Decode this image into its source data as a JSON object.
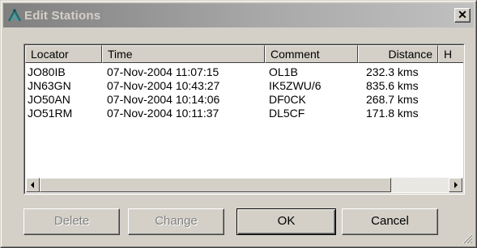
{
  "window": {
    "title": "Edit Stations",
    "close_glyph": "✕"
  },
  "icons": {
    "app": "antenna-icon",
    "close": "close-icon",
    "scroll_left": "arrow-left-icon",
    "scroll_right": "arrow-right-icon",
    "grip": "resize-grip-icon"
  },
  "table": {
    "headers": {
      "locator": "Locator",
      "time": "Time",
      "comment": "Comment",
      "distance": "Distance",
      "h": "H"
    },
    "rows": [
      {
        "locator": "JO80IB",
        "time": "07-Nov-2004 11:07:15",
        "comment": "OL1B",
        "distance": "232.3 kms"
      },
      {
        "locator": "JN63GN",
        "time": "07-Nov-2004 10:43:27",
        "comment": "IK5ZWU/6",
        "distance": "835.6 kms"
      },
      {
        "locator": "JO50AN",
        "time": "07-Nov-2004 10:14:06",
        "comment": "DF0CK",
        "distance": "268.7 kms"
      },
      {
        "locator": "JO51RM",
        "time": "07-Nov-2004 10:11:37",
        "comment": "DL5CF",
        "distance": "171.8 kms"
      }
    ]
  },
  "buttons": {
    "delete": "Delete",
    "change": "Change",
    "ok": "OK",
    "cancel": "Cancel"
  },
  "colors": {
    "face": "#d4d0c8",
    "title_inactive": "#808080",
    "disabled_text": "#808080"
  }
}
